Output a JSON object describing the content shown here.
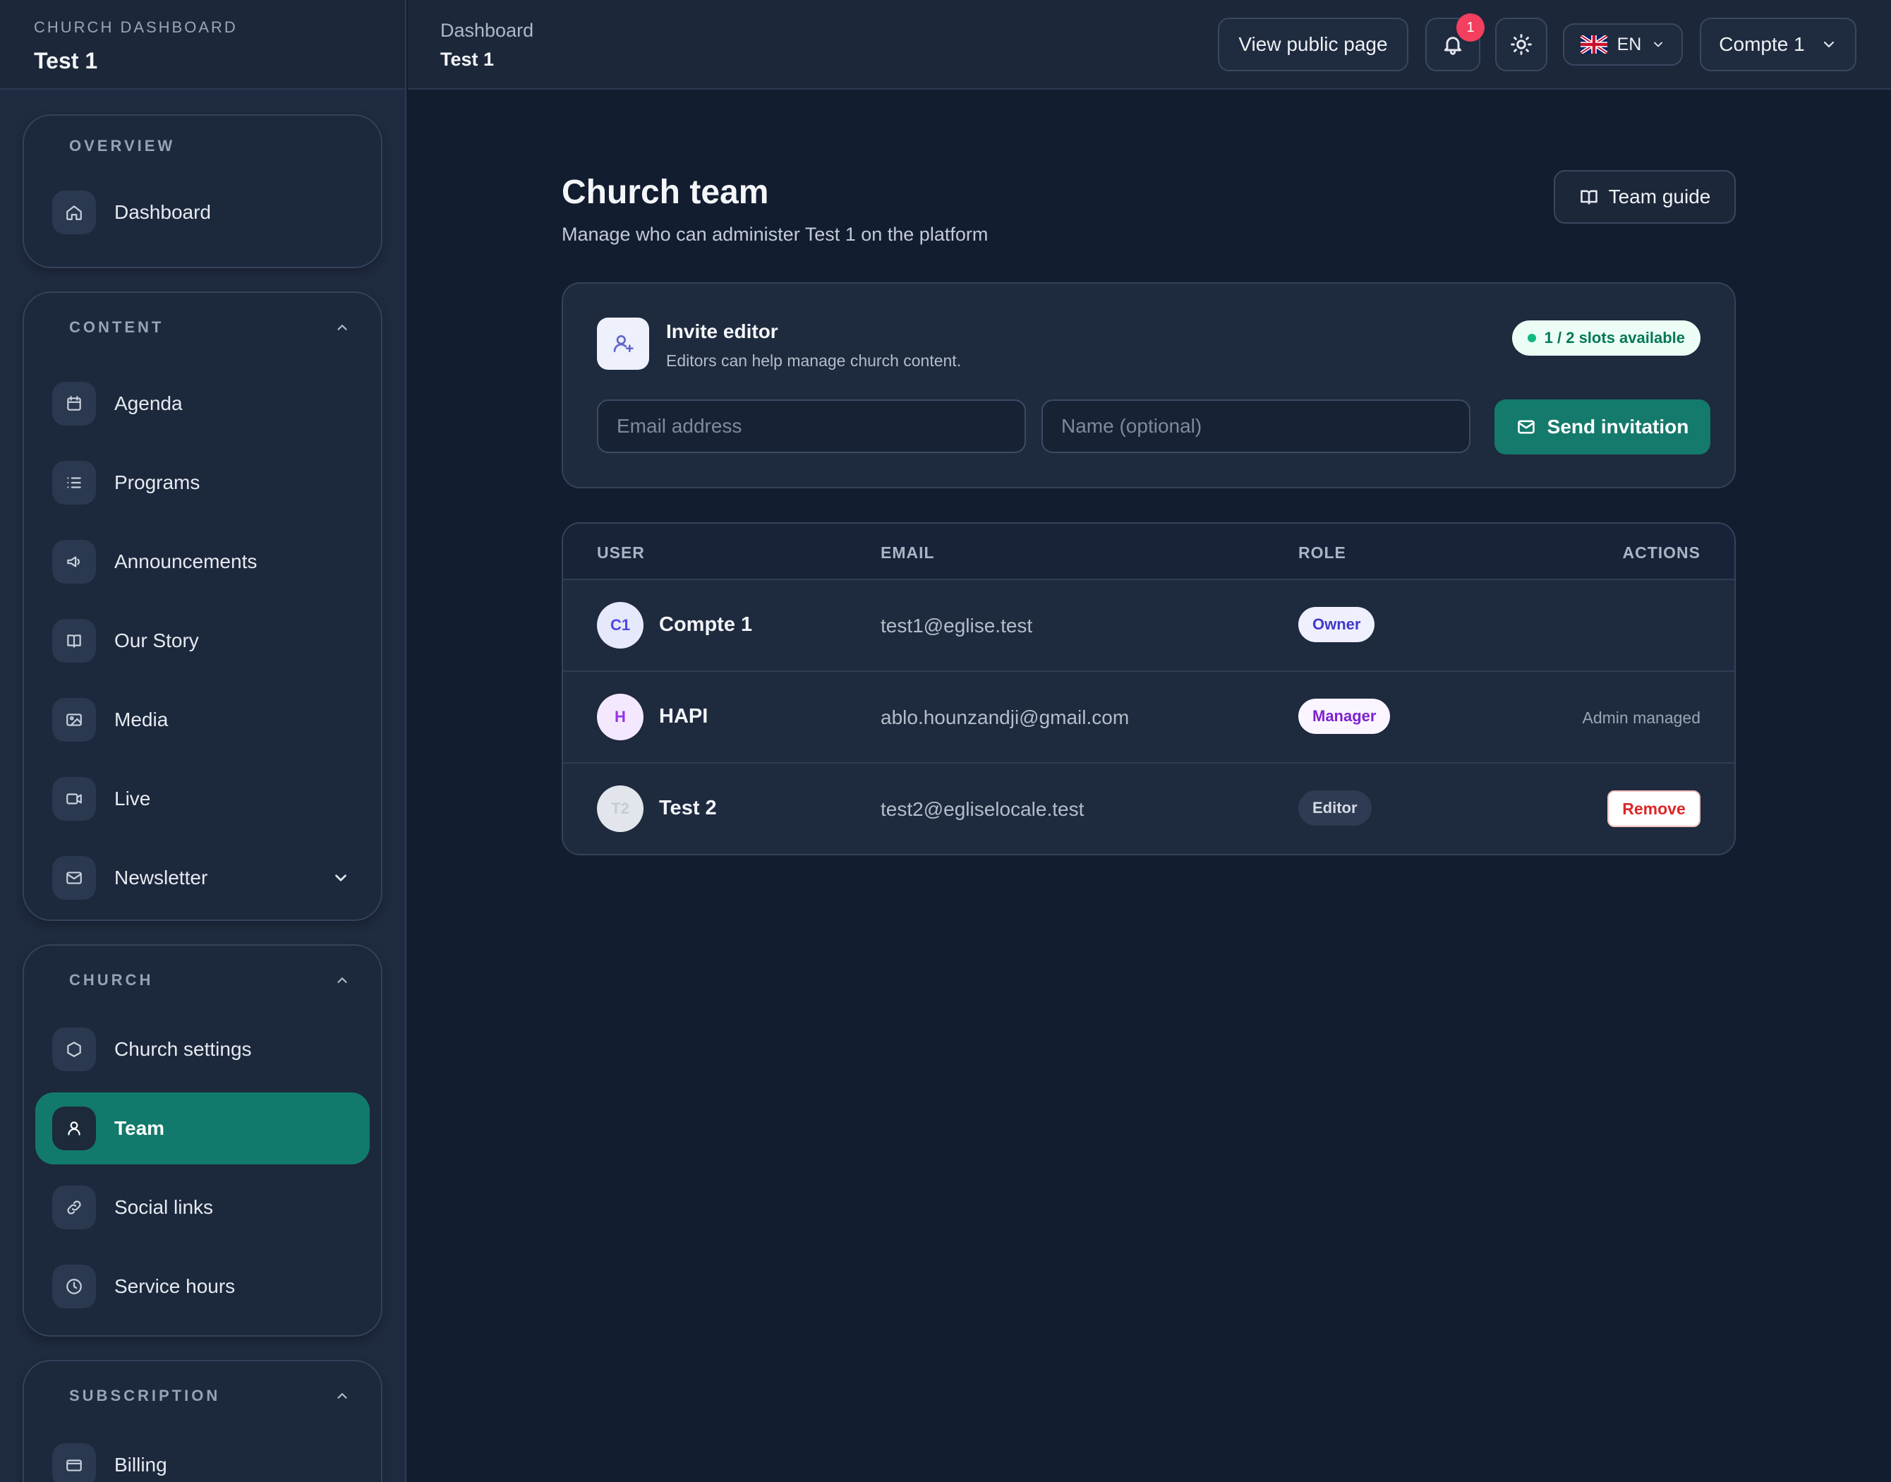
{
  "brand": {
    "kicker": "CHURCH DASHBOARD",
    "title": "Test 1"
  },
  "sidebar": {
    "overview": {
      "title": "OVERVIEW",
      "items": [
        {
          "label": "Dashboard",
          "icon": "home-icon"
        }
      ]
    },
    "content": {
      "title": "CONTENT",
      "items": [
        {
          "label": "Agenda",
          "icon": "calendar-icon"
        },
        {
          "label": "Programs",
          "icon": "list-icon"
        },
        {
          "label": "Announcements",
          "icon": "megaphone-icon"
        },
        {
          "label": "Our Story",
          "icon": "book-icon"
        },
        {
          "label": "Media",
          "icon": "image-icon"
        },
        {
          "label": "Live",
          "icon": "video-icon"
        },
        {
          "label": "Newsletter",
          "icon": "mail-icon"
        }
      ]
    },
    "church": {
      "title": "CHURCH",
      "items": [
        {
          "label": "Church settings",
          "icon": "hexagon-icon"
        },
        {
          "label": "Team",
          "icon": "user-icon",
          "active": true
        },
        {
          "label": "Social links",
          "icon": "link-icon"
        },
        {
          "label": "Service hours",
          "icon": "clock-icon"
        }
      ]
    },
    "subscription": {
      "title": "SUBSCRIPTION",
      "items": [
        {
          "label": "Billing",
          "icon": "credit-card-icon"
        }
      ]
    }
  },
  "header": {
    "breadcrumb_small": "Dashboard",
    "breadcrumb_main": "Test 1",
    "view_public": "View public page",
    "notification_count": "1",
    "language": "EN",
    "account": "Compte 1"
  },
  "page": {
    "title": "Church team",
    "subtitle": "Manage who can administer Test 1 on the platform",
    "guide_button": "Team guide"
  },
  "invite": {
    "title": "Invite editor",
    "subtitle": "Editors can help manage church content.",
    "slots": "1 / 2 slots available",
    "email_placeholder": "Email address",
    "name_placeholder": "Name (optional)",
    "send_label": "Send invitation"
  },
  "table": {
    "headers": {
      "user": "USER",
      "email": "EMAIL",
      "role": "ROLE",
      "actions": "ACTIONS"
    },
    "rows": [
      {
        "initials": "C1",
        "name": "Compte 1",
        "email": "test1@eglise.test",
        "role": "Owner",
        "action": ""
      },
      {
        "initials": "H",
        "name": "HAPI",
        "email": "ablo.hounzandji@gmail.com",
        "role": "Manager",
        "action": "Admin managed"
      },
      {
        "initials": "T2",
        "name": "Test 2",
        "email": "test2@egliselocale.test",
        "role": "Editor",
        "action": "Remove"
      }
    ]
  },
  "colors": {
    "accent": "#127a6c",
    "background": "#131d30",
    "sidebar": "#1f2b40",
    "notification": "#f43f5e",
    "danger": "#dc2626"
  }
}
